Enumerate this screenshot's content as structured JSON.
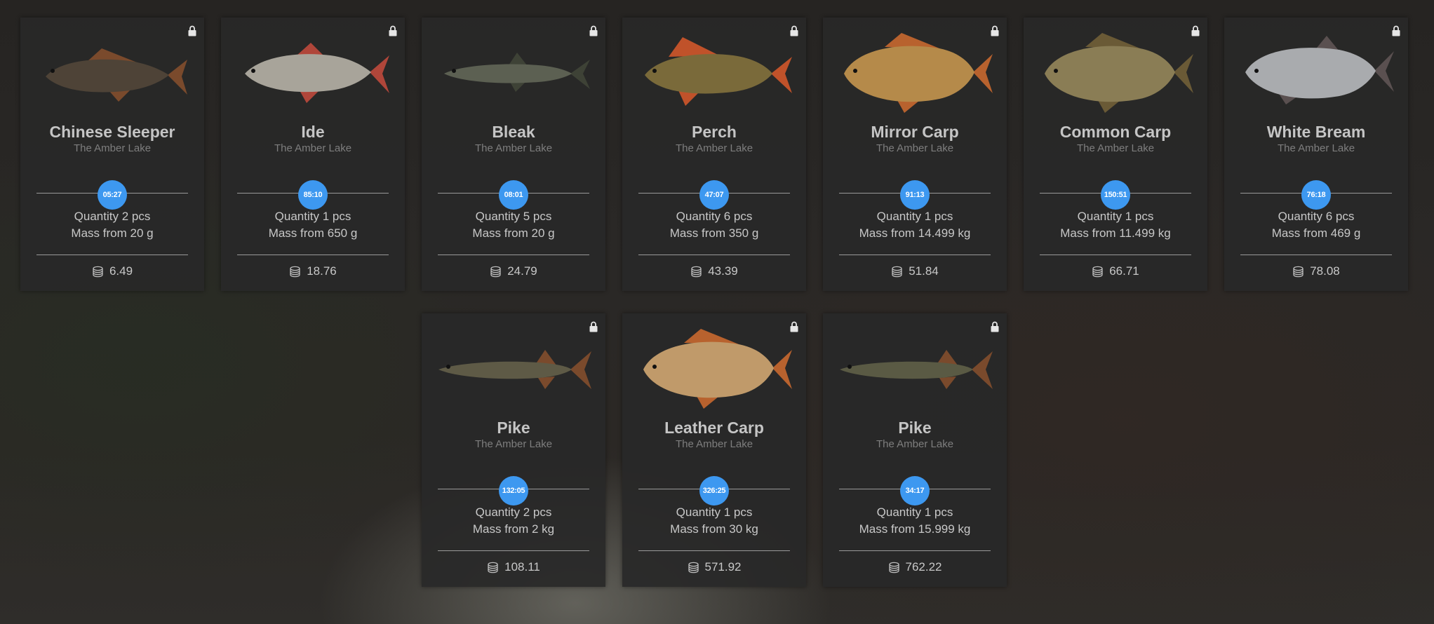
{
  "location_default": "The Amber Lake",
  "colors": {
    "timer_bg": "#3d98f0",
    "card_bg": "#282828"
  },
  "icons": {
    "lock": "lock-icon",
    "currency": "coins-icon"
  },
  "cards": [
    {
      "name": "Chinese Sleeper",
      "location": "The Amber Lake",
      "timer": "05:27",
      "quantity": "Quantity 2 pcs",
      "mass": "Mass from 20 g",
      "price": "6.49",
      "body": "#4e4337",
      "fin": "#7a4a2c",
      "shape": "sleeper"
    },
    {
      "name": "Ide",
      "location": "The Amber Lake",
      "timer": "85:10",
      "quantity": "Quantity 1 pcs",
      "mass": "Mass from 650 g",
      "price": "18.76",
      "body": "#a8a49a",
      "fin": "#b0463a",
      "shape": "roach"
    },
    {
      "name": "Bleak",
      "location": "The Amber Lake",
      "timer": "08:01",
      "quantity": "Quantity 5 pcs",
      "mass": "Mass from 20 g",
      "price": "24.79",
      "body": "#5c6052",
      "fin": "#3e4236",
      "shape": "slim"
    },
    {
      "name": "Perch",
      "location": "The Amber Lake",
      "timer": "47:07",
      "quantity": "Quantity 6 pcs",
      "mass": "Mass from 350 g",
      "price": "43.39",
      "body": "#7a6a3a",
      "fin": "#c0522a",
      "shape": "perch"
    },
    {
      "name": "Mirror Carp",
      "location": "The Amber Lake",
      "timer": "91:13",
      "quantity": "Quantity 1 pcs",
      "mass": "Mass from 14.499 kg",
      "price": "51.84",
      "body": "#b58a4a",
      "fin": "#b8622e",
      "shape": "carp"
    },
    {
      "name": "Common Carp",
      "location": "The Amber Lake",
      "timer": "150:51",
      "quantity": "Quantity 1 pcs",
      "mass": "Mass from 11.499 kg",
      "price": "66.71",
      "body": "#8a7d55",
      "fin": "#6a5a36",
      "shape": "carp"
    },
    {
      "name": "White Bream",
      "location": "The Amber Lake",
      "timer": "76:18",
      "quantity": "Quantity 6 pcs",
      "mass": "Mass from 469 g",
      "price": "78.08",
      "body": "#a9abae",
      "fin": "#5a5050",
      "shape": "bream"
    },
    {
      "name": "Pike",
      "location": "The Amber Lake",
      "timer": "132:05",
      "quantity": "Quantity 2 pcs",
      "mass": "Mass from 2 kg",
      "price": "108.11",
      "body": "#5e5a46",
      "fin": "#7a4a2c",
      "shape": "pike"
    },
    {
      "name": "Leather Carp",
      "location": "The Amber Lake",
      "timer": "326:25",
      "quantity": "Quantity 1 pcs",
      "mass": "Mass from 30 kg",
      "price": "571.92",
      "body": "#c09a6a",
      "fin": "#b8622e",
      "shape": "carp"
    },
    {
      "name": "Pike",
      "location": "The Amber Lake",
      "timer": "34:17",
      "quantity": "Quantity 1 pcs",
      "mass": "Mass from 15.999 kg",
      "price": "762.22",
      "body": "#5a5a44",
      "fin": "#7a4a2c",
      "shape": "pike"
    }
  ]
}
